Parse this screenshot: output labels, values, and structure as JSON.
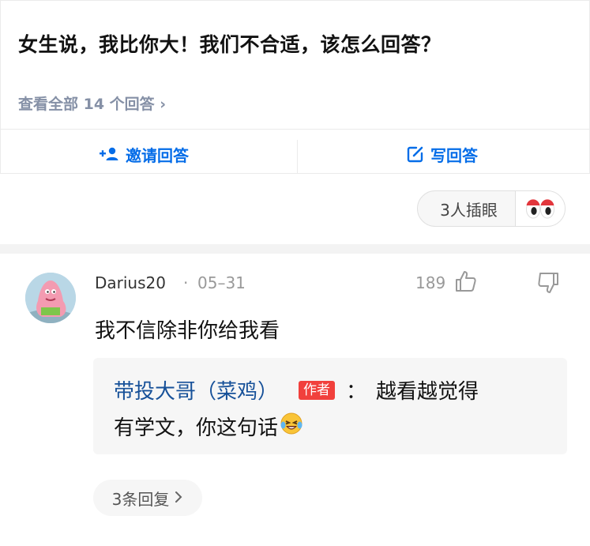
{
  "question": {
    "title": "女生说，我比你大！我们不合适，该怎么回答？",
    "view_all": "查看全部 14 个回答 ›",
    "invite_label": "邀请回答",
    "write_label": "写回答"
  },
  "reaction": {
    "text": "3人插眼",
    "icon": "eyes-icon"
  },
  "comment": {
    "author": "Darius20",
    "separator": "·",
    "date": "05–31",
    "likes": "189",
    "text": "我不信除非你给我看",
    "reply": {
      "author": "带投大哥（菜鸡）",
      "badge": "作者",
      "colon": "：",
      "text_line1": "越看越觉得",
      "text_line2": "有学文，你这句话",
      "emoji": "laughing-tears-emoji"
    },
    "replies_label": "3条回复"
  },
  "colors": {
    "accent": "#056de8",
    "author_link": "#175199",
    "badge": "#f1403c",
    "muted": "#8590a6"
  }
}
